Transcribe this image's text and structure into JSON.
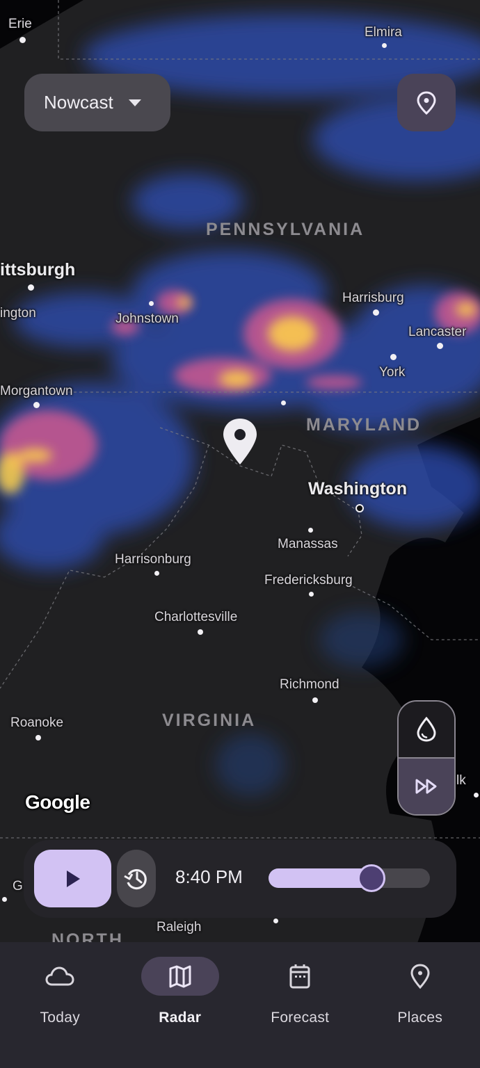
{
  "map": {
    "cities": [
      {
        "name": "Erie",
        "size": "normal"
      },
      {
        "name": "Elmira",
        "size": "normal"
      },
      {
        "name": "ittsburgh",
        "size": "big"
      },
      {
        "name": "ington",
        "size": "normal"
      },
      {
        "name": "Johnstown",
        "size": "normal"
      },
      {
        "name": "Harrisburg",
        "size": "normal"
      },
      {
        "name": "Lancaster",
        "size": "normal"
      },
      {
        "name": "York",
        "size": "normal"
      },
      {
        "name": "Morgantown",
        "size": "normal"
      },
      {
        "name": "Washington",
        "size": "big"
      },
      {
        "name": "Manassas",
        "size": "normal"
      },
      {
        "name": "Harrisonburg",
        "size": "normal"
      },
      {
        "name": "Fredericksburg",
        "size": "normal"
      },
      {
        "name": "Charlottesville",
        "size": "normal"
      },
      {
        "name": "Richmond",
        "size": "normal"
      },
      {
        "name": "Roanoke",
        "size": "normal"
      },
      {
        "name": "lk",
        "size": "normal"
      },
      {
        "name": "G",
        "size": "normal"
      },
      {
        "name": "Raleigh",
        "size": "normal"
      }
    ],
    "states": [
      "PENNSYLVANIA",
      "MARYLAND",
      "VIRGINIA",
      "NORTH"
    ],
    "attribution": "Google",
    "marker": "location-pin"
  },
  "controls": {
    "model_select": {
      "value": "Nowcast",
      "icon": "dropdown-caret"
    },
    "my_location_icon": "location-pin-icon",
    "layer_toggle": [
      {
        "icon": "water-drop-icon",
        "label": "Precipitation",
        "selected": false
      },
      {
        "icon": "fast-forward-icon",
        "label": "Forecast",
        "selected": true
      }
    ]
  },
  "playback": {
    "play_icon": "play-icon",
    "history_icon": "history-icon",
    "time": "8:40 PM",
    "progress": 0.64
  },
  "bottom_nav": {
    "items": [
      {
        "label": "Today",
        "icon": "cloud-icon",
        "active": false
      },
      {
        "label": "Radar",
        "icon": "map-icon",
        "active": true
      },
      {
        "label": "Forecast",
        "icon": "calendar-icon",
        "active": false
      },
      {
        "label": "Places",
        "icon": "location-pin-icon",
        "active": false
      }
    ]
  },
  "colors": {
    "accent": "#d2c2f3",
    "accent_dark": "#4d3f72",
    "surface": "#252429",
    "nav_bg": "#28272f",
    "radar_low": "#3a5bd1",
    "radar_mid": "#e8608a",
    "radar_high": "#fff04a"
  }
}
